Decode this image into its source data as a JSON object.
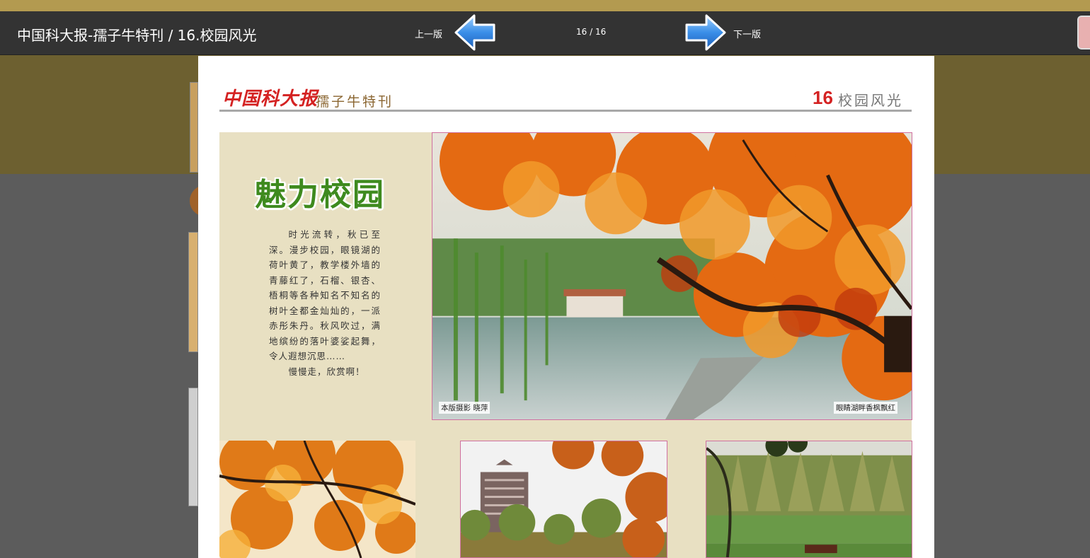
{
  "viewer": {
    "title": "中国科大报-孺子牛特刊 / 16.校园风光",
    "prev_label": "上一版",
    "next_label": "下一版",
    "page_counter": "16 / 16",
    "accent_color": "#3a8ee8"
  },
  "newspaper": {
    "masthead": "中国科大报",
    "subtitle": "孺子牛特刊",
    "section_number": "16",
    "section_name": "校园风光",
    "headline": "魅力校园",
    "article_paragraphs": [
      "时光流转，秋已至深。漫步校园，眼镜湖的荷叶黄了，教学楼外墙的青藤红了，石榴、银杏、梧桐等各种知名不知名的树叶全都金灿灿的，一派赤彤朱丹。秋风吹过，满地缤纷的落叶婆娑起舞，令人遐想沉思……",
      "慢慢走，欣赏啊！"
    ],
    "photo_credit": "本版摄影 晓萍",
    "main_photo_caption": "眼睛湖畔香枫飘红"
  }
}
